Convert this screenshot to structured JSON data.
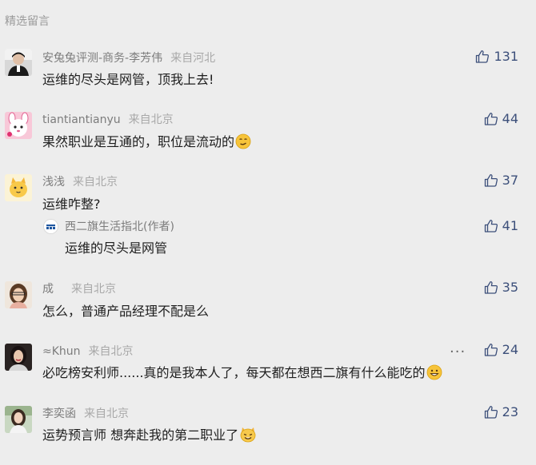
{
  "section_title": "精选留言",
  "colors": {
    "background": "#ededed",
    "like_blue": "#3c4f7a",
    "name_grey": "#7c7c7c"
  },
  "comments": [
    {
      "name": "安兔兔评测-商务-李芳伟",
      "location": "来自河北",
      "text": "运维的尽头是网管，顶我上去!",
      "likes": "131",
      "avatar_icon": "user-photo-avatar"
    },
    {
      "name": "tiantiantianyu",
      "location": "来自北京",
      "text": "果然职业是互通的，职位是流动的",
      "likes": "44",
      "emoji": "smirk-face-emoji",
      "avatar_icon": "cartoon-rabbit-avatar"
    },
    {
      "name": "浅浅",
      "location": "来自北京",
      "text": "运维咋整?",
      "likes": "37",
      "avatar_icon": "cartoon-cat-avatar",
      "reply": {
        "name": "西二旗生活指北(作者)",
        "text": "运维的尽头是网管",
        "likes": "41",
        "avatar_icon": "author-logo-avatar"
      }
    },
    {
      "name": "成",
      "location": "来自北京",
      "text": "怎么，普通产品经理不配是么",
      "likes": "35",
      "avatar_icon": "woman-photo-avatar"
    },
    {
      "name": "≈Khun",
      "location": "来自北京",
      "text": "必吃榜安利师......真的是我本人了，每天都在想西二旗有什么能吃的",
      "likes": "24",
      "emoji": "grin-face-emoji",
      "more": "···",
      "avatar_icon": "woman-dark-photo-avatar"
    },
    {
      "name": "李奕函",
      "location": "来自北京",
      "text": "运势预言师 想奔赴我的第二职业了",
      "likes": "23",
      "emoji": "cat-face-emoji",
      "avatar_icon": "girl-photo-avatar"
    }
  ]
}
